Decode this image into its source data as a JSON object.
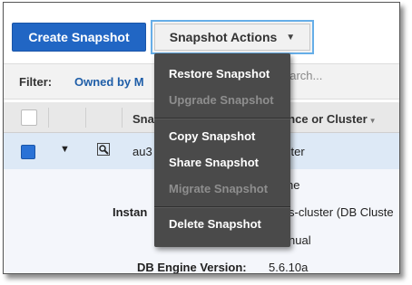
{
  "toolbar": {
    "create_label": "Create Snapshot",
    "actions_label": "Snapshot Actions"
  },
  "filter": {
    "label": "Filter:",
    "value": "Owned by M",
    "search_placeholder": "earch..."
  },
  "table": {
    "headers": [
      "Sna",
      "ance or Cluster"
    ],
    "row": {
      "id": "au3",
      "cluster": "ster"
    }
  },
  "details": {
    "line1_value": "ne",
    "instance_label": "Instan",
    "instance_value": "s-cluster (DB Cluste",
    "line3_value": "nual",
    "engine_label": "DB Engine Version:",
    "engine_value": "5.6.10a"
  },
  "menu": {
    "restore": "Restore Snapshot",
    "upgrade": "Upgrade Snapshot",
    "copy": "Copy Snapshot",
    "share": "Share Snapshot",
    "migrate": "Migrate Snapshot",
    "delete": "Delete Snapshot"
  },
  "colors": {
    "primary_button": "#2166c4",
    "menu_bg": "#4a4a4a",
    "selected_row": "#dde9f6",
    "link": "#1f5ea8"
  },
  "icons": {
    "actions_dropdown": "chevron-down-icon",
    "row_expand": "triangle-down-icon",
    "row_details": "magnifier-icon",
    "sort": "sort-caret-icon"
  }
}
